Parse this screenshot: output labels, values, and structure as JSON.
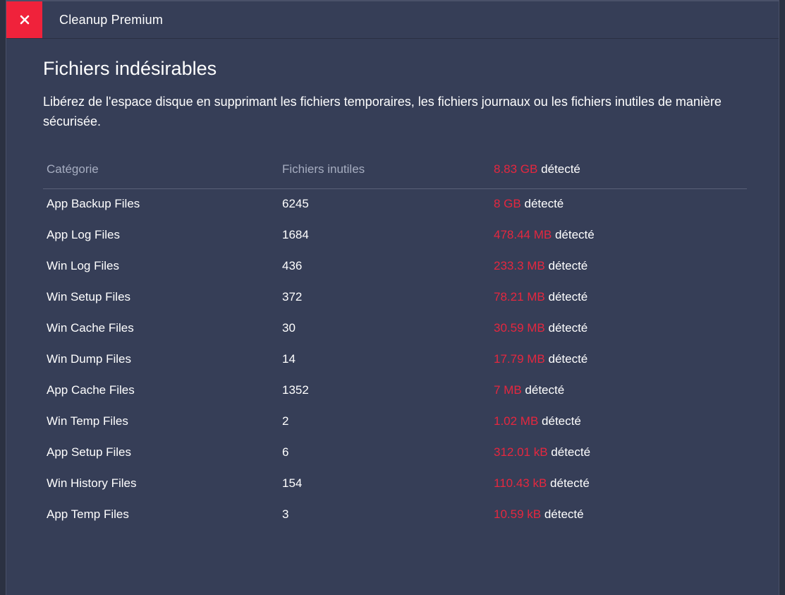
{
  "titlebar": {
    "app_title": "Cleanup Premium"
  },
  "page": {
    "title": "Fichiers indésirables",
    "description": "Libérez de l'espace disque en supprimant les fichiers temporaires, les fichiers journaux ou les fichiers inutiles de manière sécurisée."
  },
  "table": {
    "header": {
      "category": "Catégorie",
      "files": "Fichiers inutiles",
      "total_size": "8.83 GB",
      "detected_label": "détecté"
    },
    "rows": [
      {
        "category": "App Backup Files",
        "files": "6245",
        "size": "8 GB",
        "detected": "détecté"
      },
      {
        "category": "App Log Files",
        "files": "1684",
        "size": "478.44 MB",
        "detected": "détecté"
      },
      {
        "category": "Win Log Files",
        "files": "436",
        "size": "233.3 MB",
        "detected": "détecté"
      },
      {
        "category": "Win Setup Files",
        "files": "372",
        "size": "78.21 MB",
        "detected": "détecté"
      },
      {
        "category": "Win Cache Files",
        "files": "30",
        "size": "30.59 MB",
        "detected": "détecté"
      },
      {
        "category": "Win Dump Files",
        "files": "14",
        "size": "17.79 MB",
        "detected": "détecté"
      },
      {
        "category": "App Cache Files",
        "files": "1352",
        "size": "7 MB",
        "detected": "détecté"
      },
      {
        "category": "Win Temp Files",
        "files": "2",
        "size": "1.02 MB",
        "detected": "détecté"
      },
      {
        "category": "App Setup Files",
        "files": "6",
        "size": "312.01 kB",
        "detected": "détecté"
      },
      {
        "category": "Win History Files",
        "files": "154",
        "size": "110.43 kB",
        "detected": "détecté"
      },
      {
        "category": "App Temp Files",
        "files": "3",
        "size": "10.59 kB",
        "detected": "détecté"
      }
    ]
  },
  "colors": {
    "accent_red": "#f0223b",
    "size_red": "#e5273f",
    "background": "#363e57"
  },
  "icons": {
    "close": "close-icon"
  }
}
